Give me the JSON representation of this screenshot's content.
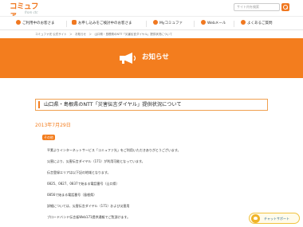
{
  "header": {
    "logo_main": "コミュファ",
    "logo_sub": "from ctc",
    "search_placeholder": "サイト内を検索"
  },
  "nav": {
    "items": [
      {
        "label": "ご利用中のお客さま"
      },
      {
        "label": "お申し込みをご検討中のお客さま"
      },
      {
        "label": "Myコミュファ"
      },
      {
        "label": "Webメール"
      },
      {
        "label": "よくあるご質問"
      }
    ]
  },
  "breadcrumb": "コミュファ光 公式サイト　＞　お知らせ　＞　山口県・島根県のNTT「災害伝言ダイヤル」提供状況について",
  "banner": {
    "title": "お知らせ"
  },
  "article": {
    "title": "山口県・島根県のNTT「災害伝言ダイヤル」提供状況について",
    "date": "2013年7月29日",
    "tag": "その他",
    "lines": [
      "平素よりインターネットサービス「コミュファ光」をご利用いただきありがとうございます。",
      "災害により、災害伝言ダイヤル（171）が利用可能となっています。",
      "伝言登録エリアは以下記の地域となります。",
      "0825、0827、0837で始まる電話番号（山口県）",
      "0856で始まる電話番号（島根県）",
      "詳細については、災害伝言ダイヤル（171）および災害用",
      "ブロードバンド伝言板Web171提供通報でご覧頂けます。"
    ]
  },
  "chatbot": {
    "label": "チャットサポート"
  },
  "colors": {
    "accent": "#f37d1e",
    "chat_border": "#f1c340"
  }
}
